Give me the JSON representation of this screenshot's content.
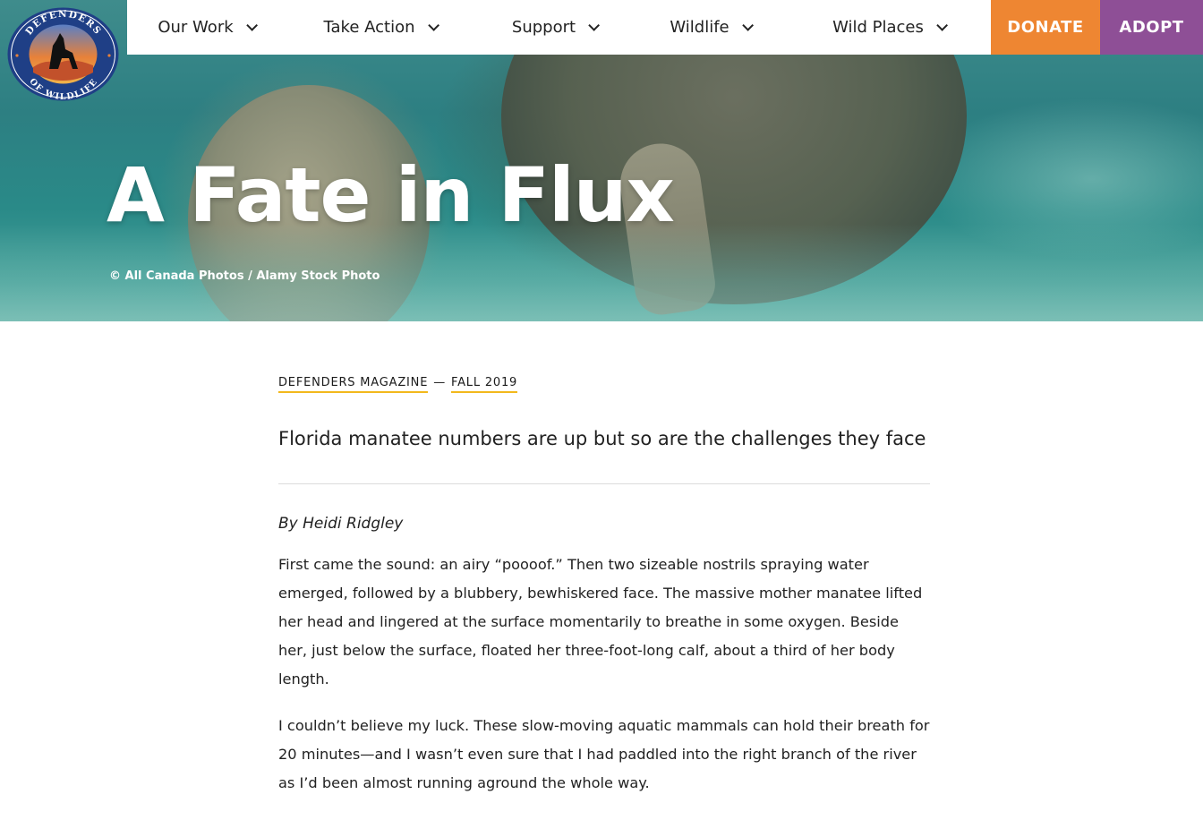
{
  "logo": {
    "text_top": "DEFENDERS",
    "text_bottom": "OF WILDLIFE"
  },
  "nav": {
    "items": [
      {
        "label": "Our Work"
      },
      {
        "label": "Take Action"
      },
      {
        "label": "Support"
      },
      {
        "label": "Wildlife"
      },
      {
        "label": "Wild Places"
      }
    ],
    "donate_label": "DONATE",
    "adopt_label": "ADOPT"
  },
  "colors": {
    "donate_bg": "#ee8632",
    "adopt_bg": "#8e4f96",
    "kicker_underline": "#f2b81c"
  },
  "hero": {
    "title": "A Fate in Flux",
    "credit": "© All Canada Photos / Alamy Stock Photo"
  },
  "article": {
    "publication": "DEFENDERS MAGAZINE",
    "separator": "—",
    "issue": "FALL 2019",
    "dek": "Florida manatee numbers are up but so are the challenges they face",
    "byline": "By Heidi Ridgley",
    "paragraphs": [
      "First came the sound: an airy “poooof.” Then two sizeable nostrils spraying water emerged, followed by a blubbery, bewhiskered face. The massive mother manatee lifted her head and lingered at the surface momentarily to breathe in some oxygen. Beside her, just below the surface, floated her three-foot-long calf, about a third of her body length.",
      "I couldn’t believe my luck. These slow-moving aquatic mammals can hold their breath for 20 minutes—and I wasn’t even sure that I had paddled into the right branch of the river as I’d been almost running aground the whole way."
    ]
  }
}
